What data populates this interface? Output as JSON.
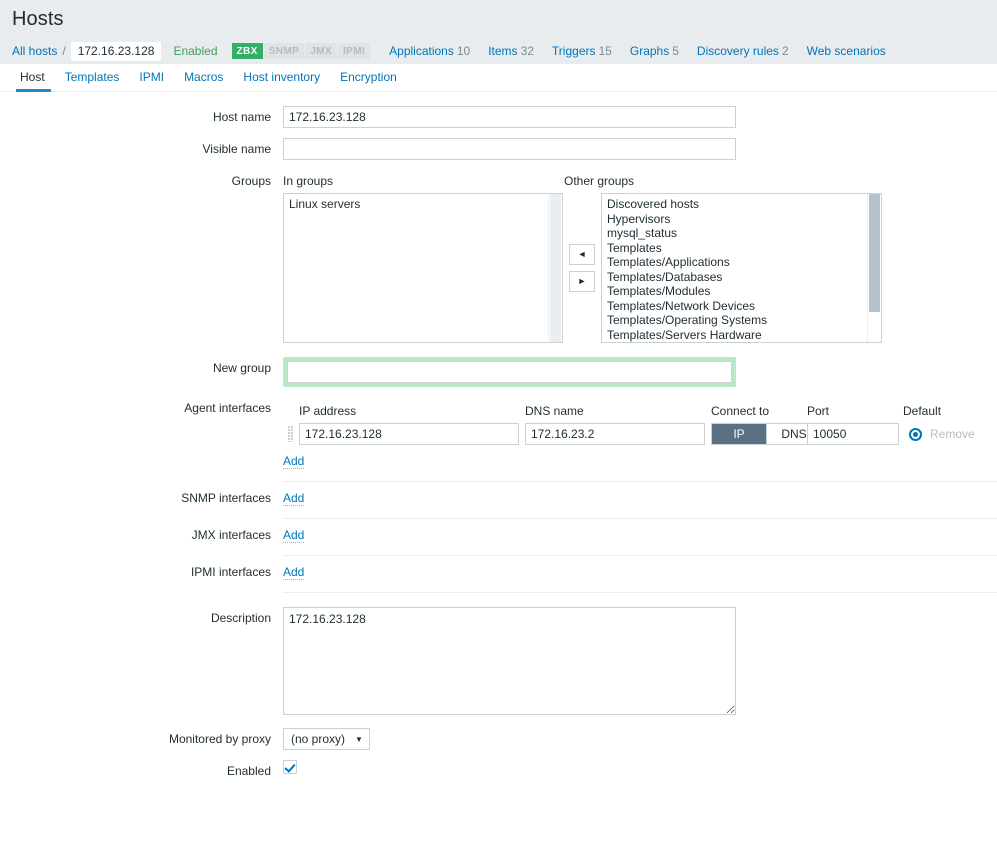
{
  "header": {
    "title": "Hosts"
  },
  "breadcrumb": {
    "all_hosts_label": "All hosts",
    "separator": "/",
    "current_host": "172.16.23.128",
    "status": "Enabled",
    "badges": [
      {
        "label": "ZBX",
        "active": true
      },
      {
        "label": "SNMP",
        "active": false
      },
      {
        "label": "JMX",
        "active": false
      },
      {
        "label": "IPMI",
        "active": false
      }
    ],
    "nav": [
      {
        "label": "Applications",
        "count": "10"
      },
      {
        "label": "Items",
        "count": "32"
      },
      {
        "label": "Triggers",
        "count": "15"
      },
      {
        "label": "Graphs",
        "count": "5"
      },
      {
        "label": "Discovery rules",
        "count": "2"
      },
      {
        "label": "Web scenarios",
        "count": ""
      }
    ]
  },
  "tabs": [
    {
      "label": "Host",
      "active": true
    },
    {
      "label": "Templates",
      "active": false
    },
    {
      "label": "IPMI",
      "active": false
    },
    {
      "label": "Macros",
      "active": false
    },
    {
      "label": "Host inventory",
      "active": false
    },
    {
      "label": "Encryption",
      "active": false
    }
  ],
  "form": {
    "host_name": {
      "label": "Host name",
      "value": "172.16.23.128"
    },
    "visible_name": {
      "label": "Visible name",
      "value": "",
      "placeholder": ""
    },
    "groups": {
      "label": "Groups",
      "in_groups_header": "In groups",
      "other_groups_header": "Other groups",
      "in_groups": [
        "Linux servers"
      ],
      "other_groups": [
        "Discovered hosts",
        "Hypervisors",
        "mysql_status",
        "Templates",
        "Templates/Applications",
        "Templates/Databases",
        "Templates/Modules",
        "Templates/Network Devices",
        "Templates/Operating Systems",
        "Templates/Servers Hardware"
      ],
      "move_left_icon": "◄",
      "move_right_icon": "►"
    },
    "new_group": {
      "label": "New group",
      "value": "",
      "placeholder": ""
    },
    "agent_interfaces": {
      "label": "Agent interfaces",
      "columns": {
        "ip": "IP address",
        "dns": "DNS name",
        "connect_to": "Connect to",
        "port": "Port",
        "default": "Default"
      },
      "rows": [
        {
          "ip": "172.16.23.128",
          "dns": "172.16.23.2",
          "connect_ip": "IP",
          "connect_dns": "DNS",
          "connect_selected": "IP",
          "port": "10050",
          "is_default": true,
          "remove_label": "Remove"
        }
      ],
      "add_label": "Add"
    },
    "snmp_interfaces": {
      "label": "SNMP interfaces",
      "add_label": "Add"
    },
    "jmx_interfaces": {
      "label": "JMX interfaces",
      "add_label": "Add"
    },
    "ipmi_interfaces": {
      "label": "IPMI interfaces",
      "add_label": "Add"
    },
    "description": {
      "label": "Description",
      "value": "172.16.23.128"
    },
    "monitored_by_proxy": {
      "label": "Monitored by proxy",
      "value": "(no proxy)",
      "caret": "▼"
    },
    "enabled": {
      "label": "Enabled",
      "checked": true
    }
  },
  "colors": {
    "accent_link": "#0275b8",
    "status_enabled": "#429e5a",
    "badge_active_bg": "#34af67",
    "toggle_selected_bg": "#5a7084",
    "new_group_highlight": "#b9e8c5",
    "header_bg": "#e8ecef"
  }
}
